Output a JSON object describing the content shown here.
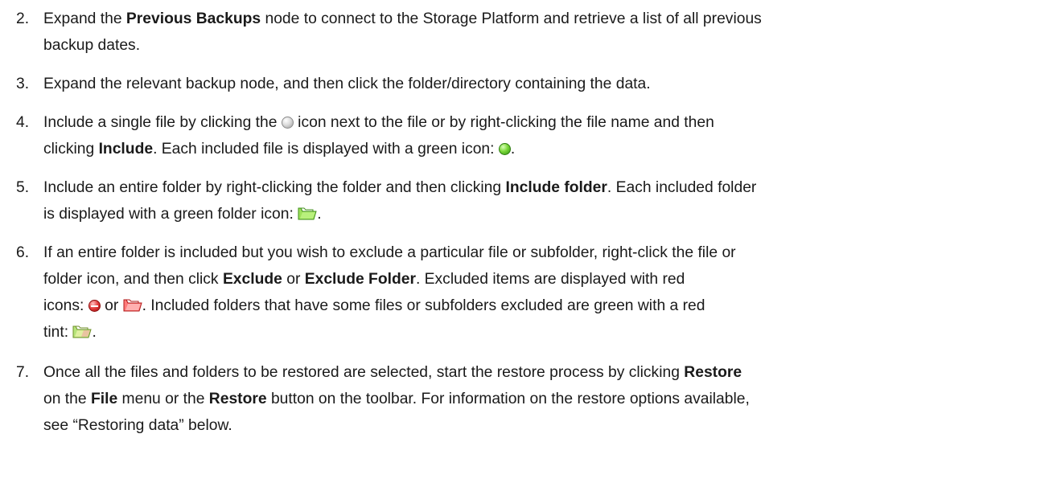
{
  "steps": [
    {
      "number": "2.",
      "line1": [
        "Expand the ",
        "Previous Backups",
        " node to connect to the Storage Platform and retrieve a list of all previous"
      ],
      "line2": [
        "backup dates."
      ]
    },
    {
      "number": "3.",
      "line1": [
        "Expand the relevant backup node, and then click the folder/directory containing the data."
      ]
    },
    {
      "number": "4.",
      "line1": [
        "Include a single file by clicking the ",
        " icon next to the file or by right-clicking the file name and then"
      ],
      "line2": [
        "clicking ",
        "Include",
        ".  Each included file is displayed with a green icon: ",
        "."
      ]
    },
    {
      "number": "5.",
      "line1": [
        "Include an entire folder by right-clicking the folder and then clicking ",
        "Include folder",
        ".  Each included folder"
      ],
      "line2": [
        "is displayed with a green folder icon: ",
        "."
      ]
    },
    {
      "number": "6.",
      "line1": [
        "If an entire folder is included but you wish to exclude a particular file or subfolder, right-click the file or"
      ],
      "line2": [
        "folder icon, and then click ",
        "Exclude",
        " or ",
        "Exclude  Folder",
        ". Excluded items are displayed with red"
      ],
      "line3": [
        "icons: ",
        " or ",
        ". Included folders that have some files or subfolders excluded are green with a red"
      ],
      "line4": [
        "tint: ",
        "."
      ]
    },
    {
      "number": "7.",
      "line1": [
        "Once all the files and folders to be restored are selected, start the restore process by clicking ",
        "Restore"
      ],
      "line2": [
        "on the ",
        "File",
        " menu or the ",
        "Restore",
        " button on the toolbar. For information on the restore options available,"
      ],
      "line3": [
        "see “Restoring data” below."
      ]
    }
  ],
  "icons": {
    "unselected_file": "grey-circle-icon",
    "included_file": "green-circle-icon",
    "included_folder": "green-folder-icon",
    "excluded_file": "red-circle-icon",
    "excluded_folder": "red-folder-icon",
    "partial_folder": "green-red-tint-folder-icon"
  },
  "colors": {
    "text": "#1a1a1a",
    "green": "#7bd83a",
    "red": "#e33a3a",
    "grey": "#c8c8c8"
  }
}
